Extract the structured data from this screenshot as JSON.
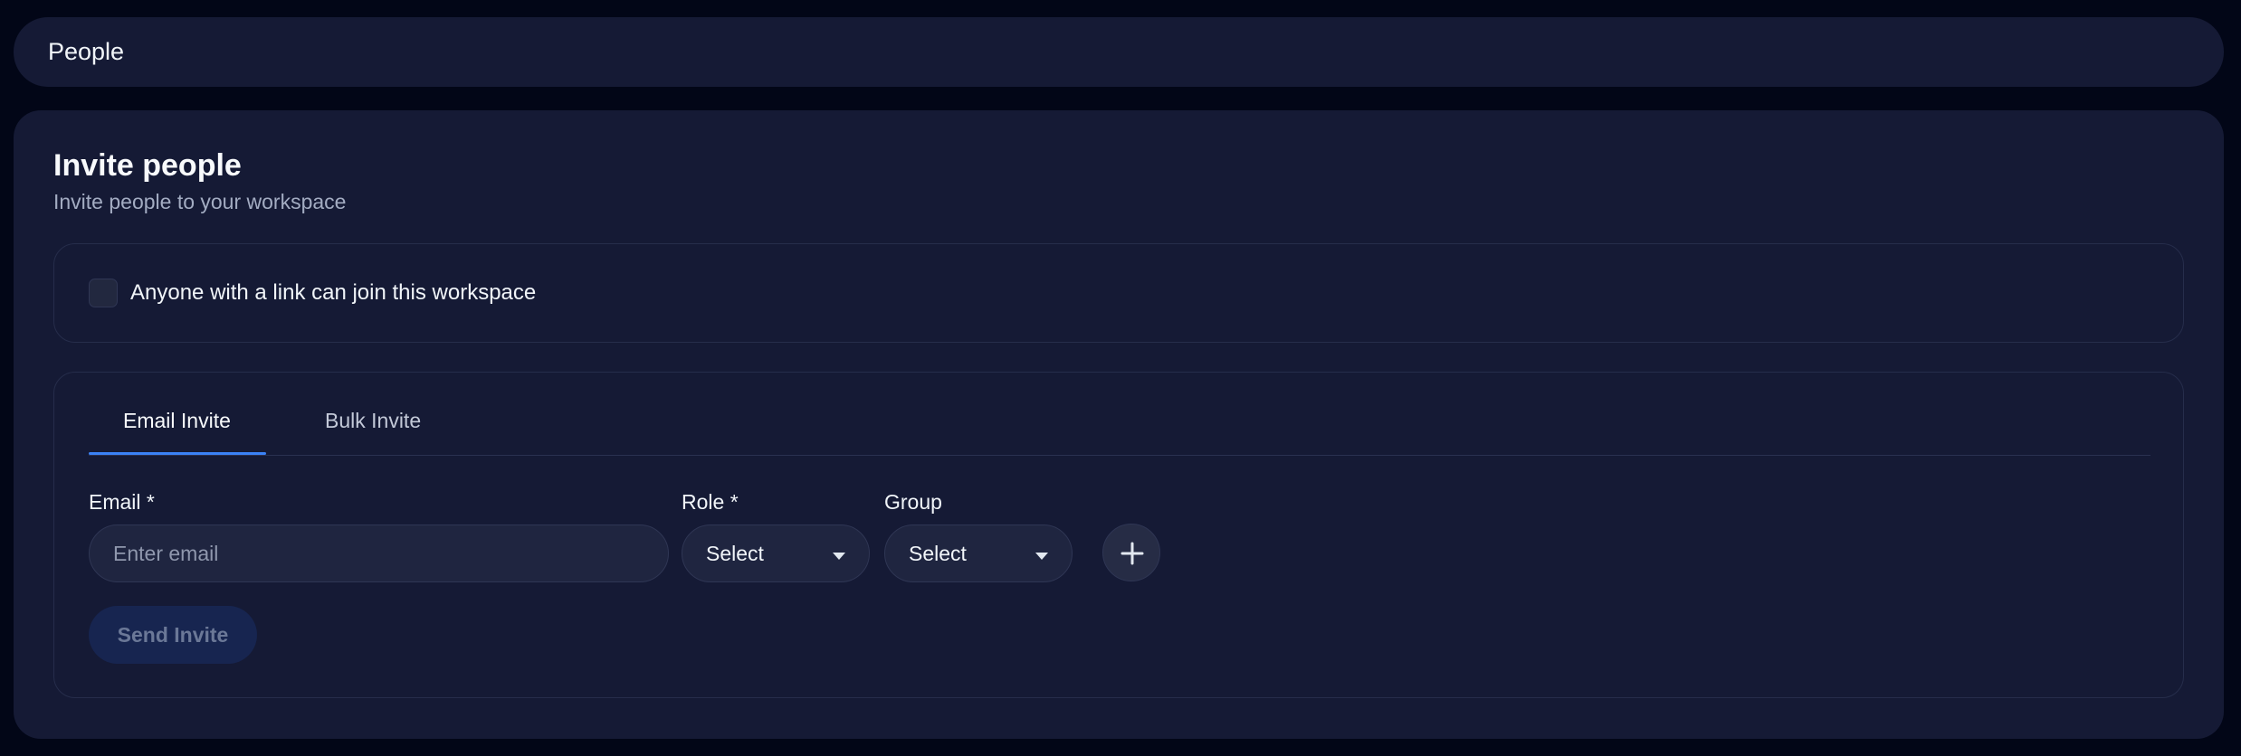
{
  "header": {
    "title": "People"
  },
  "invite_card": {
    "title": "Invite people",
    "subtitle": "Invite people to your workspace"
  },
  "link_option": {
    "label": "Anyone with a link can join this workspace",
    "checked": false
  },
  "tabs": [
    {
      "label": "Email Invite",
      "active": true
    },
    {
      "label": "Bulk Invite",
      "active": false
    }
  ],
  "form": {
    "email_label": "Email *",
    "email_placeholder": "Enter email",
    "email_value": "",
    "role_label": "Role *",
    "role_value": "Select",
    "group_label": "Group",
    "group_value": "Select",
    "send_label": "Send Invite"
  },
  "icons": {
    "add": "plus-icon",
    "dropdown": "chevron-down-icon"
  },
  "colors": {
    "background": "#020617",
    "surface": "#151a35",
    "accent": "#3b82f6",
    "send_button_bg": "#172550"
  }
}
